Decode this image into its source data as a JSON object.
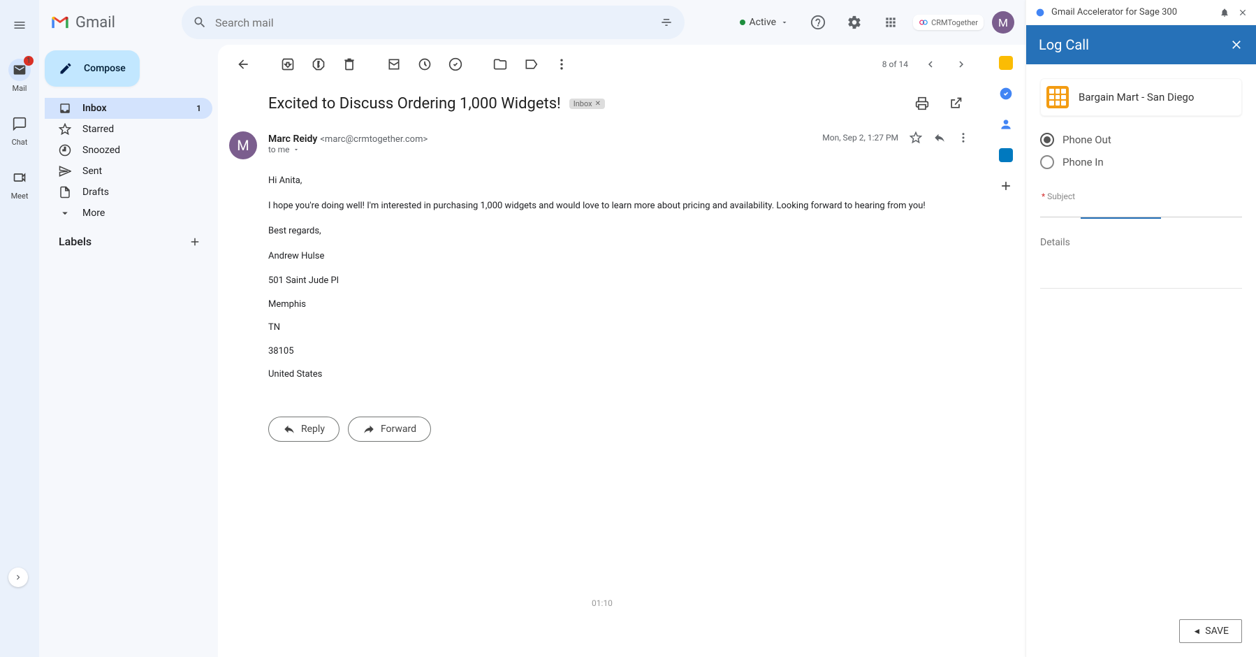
{
  "app": {
    "name": "Gmail"
  },
  "rail": {
    "mail": {
      "label": "Mail",
      "badge": "1"
    },
    "chat": {
      "label": "Chat"
    },
    "meet": {
      "label": "Meet"
    }
  },
  "search": {
    "placeholder": "Search mail"
  },
  "status": {
    "label": "Active"
  },
  "avatar": {
    "initial": "M"
  },
  "crm_chip": {
    "label": "CRMTogether"
  },
  "compose": {
    "label": "Compose"
  },
  "nav": {
    "inbox": {
      "label": "Inbox",
      "count": "1"
    },
    "starred": {
      "label": "Starred"
    },
    "snoozed": {
      "label": "Snoozed"
    },
    "sent": {
      "label": "Sent"
    },
    "drafts": {
      "label": "Drafts"
    },
    "more": {
      "label": "More"
    }
  },
  "labels": {
    "header": "Labels"
  },
  "pagination": {
    "text": "8 of 14"
  },
  "email": {
    "subject": "Excited to Discuss Ordering 1,000 Widgets!",
    "chip": "Inbox",
    "sender_name": "Marc Reidy",
    "sender_email": "<marc@crmtogether.com>",
    "to_line": "to me",
    "timestamp": "Mon, Sep 2, 1:27 PM",
    "avatar_initial": "M",
    "body": {
      "greeting": "Hi Anita,",
      "p1": "I hope you're doing well! I'm interested in purchasing 1,000 widgets and would love to learn more about pricing and availability. Looking forward to hearing from you!",
      "closing": "Best regards,",
      "sig_name": "Andrew Hulse",
      "addr1": "501 Saint Jude Pl",
      "addr2": "Memphis",
      "addr3": "TN",
      "addr4": "38105",
      "addr5": "United States"
    },
    "reply": "Reply",
    "forward": "Forward"
  },
  "ext": {
    "title": "Gmail Accelerator for Sage 300",
    "panel_title": "Log Call",
    "account": "Bargain Mart - San Diego",
    "radio_out": "Phone Out",
    "radio_in": "Phone In",
    "subject_label": "Subject",
    "details_label": "Details",
    "save": "SAVE"
  },
  "footer_time": "01:10"
}
